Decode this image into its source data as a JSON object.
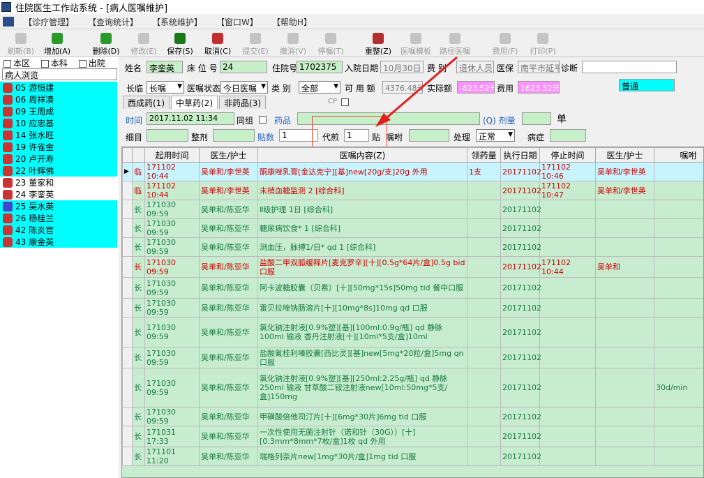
{
  "window": {
    "title": "住院医生工作站系统 - [病人医嘱维护]"
  },
  "menu": [
    "【诊疗管理】",
    "【查询统计】",
    "【系统维护】",
    "【窗口W】",
    "【帮助H】"
  ],
  "toolbar": [
    {
      "label": "刷新(B)",
      "state": "disabled"
    },
    {
      "label": "增加(A)",
      "state": "enabled"
    },
    {
      "label": "删除(D)",
      "state": "enabled"
    },
    {
      "label": "修改(E)",
      "state": "disabled"
    },
    {
      "label": "保存(S)",
      "state": "enabled"
    },
    {
      "label": "取消(C)",
      "state": "enabled"
    },
    {
      "label": "提交(E)",
      "state": "disabled"
    },
    {
      "label": "撤消(V)",
      "state": "disabled"
    },
    {
      "label": "停嘱(T)",
      "state": "disabled"
    },
    {
      "label": "重整(Z)",
      "state": "enabled"
    },
    {
      "label": "医嘱模板",
      "state": "disabled"
    },
    {
      "label": "路径医嘱",
      "state": "disabled"
    },
    {
      "label": "费用(F)",
      "state": "disabled"
    },
    {
      "label": "打印(P)",
      "state": "disabled"
    }
  ],
  "filters": {
    "ward": "本区",
    "dept": "本科",
    "discharged": "出院"
  },
  "patient_list": {
    "title": "病人浏览",
    "items": [
      {
        "bed": "05",
        "name": "游恒建"
      },
      {
        "bed": "06",
        "name": "周祥凑"
      },
      {
        "bed": "09",
        "name": "王周成"
      },
      {
        "bed": "10",
        "name": "应忠基"
      },
      {
        "bed": "14",
        "name": "张水旺"
      },
      {
        "bed": "19",
        "name": "许雀金"
      },
      {
        "bed": "20",
        "name": "卢开寿"
      },
      {
        "bed": "22",
        "name": "叶辉佛"
      },
      {
        "bed": "23",
        "name": "董家和"
      },
      {
        "bed": "24",
        "name": "李銮英"
      },
      {
        "bed": "25",
        "name": "吴水英"
      },
      {
        "bed": "26",
        "name": "杨桂兰"
      },
      {
        "bed": "42",
        "name": "陈炎官"
      },
      {
        "bed": "43",
        "name": "康金英"
      }
    ]
  },
  "info": {
    "name_label": "姓名",
    "name": "李銮英",
    "bed_label": "床 位 号",
    "bed": "24",
    "adm_no_label": "住院号",
    "adm_no": "1702375",
    "adm_date_label": "入院日期",
    "adm_date": "10月30日",
    "fee_cat_label": "费  别",
    "fee_cat": "退休人员",
    "ins_label": "医保",
    "ins": "南平市延平",
    "diag_label": "诊断",
    "diag": "",
    "term_label": "长临",
    "term": "长嘱",
    "status_label": "医嘱状态",
    "status": "今日医嘱",
    "type_label": "类  别",
    "type": "全部",
    "avail_label": "可 用 额",
    "avail": "4376.48元",
    "actual_label": "实际额",
    "actual": "-623.52元",
    "fee_label": "费用",
    "fee": "1623.52元",
    "level": "普通"
  },
  "tabs": [
    "西成药(1)",
    "中草药(2)",
    "非药品(3)"
  ],
  "entry": {
    "time_label": "时间",
    "time": "2017.11.02 11:34",
    "group_label": "同组",
    "drug_label": "药品",
    "drug": "",
    "dose_label": "(Q) 剂量",
    "dose": "",
    "unit": "单",
    "detail_label": "细目",
    "detail": "",
    "whole_label": "整剂",
    "whole": "",
    "packs_label": "贴数",
    "packs": "1",
    "prev_label": "代煎",
    "prev": "1",
    "tie": "贴",
    "note_label": "嘱咐",
    "note": "",
    "handle_label": "处理",
    "handle": "正常",
    "cp": "CP",
    "illness_label": "病症",
    "illness": ""
  },
  "table": {
    "headers": [
      "起用时间",
      "医生/护士",
      "医嘱内容(Z)",
      "领药量",
      "执行日期",
      "停止时间",
      "医生/护士",
      "嘱咐"
    ],
    "rows": [
      {
        "t": "临",
        "start": "171102 10:44",
        "doc": "吴单和/李世英",
        "content": "酮康唑乳膏[金达克宁][基]new[20g/支]20g  外用",
        "qty": "1支",
        "exec": "20171102",
        "stop": "171102 10:46",
        "doc2": "吴单和/李世英",
        "note": "",
        "red": true,
        "hl": true
      },
      {
        "t": "临",
        "start": "171102 10:44",
        "doc": "吴单和/李世英",
        "content": "末梢血糖监测  2 [综合科]",
        "qty": "",
        "exec": "20171102",
        "stop": "171102 10:47",
        "doc2": "吴单和/李世英",
        "note": "",
        "red": true
      },
      {
        "t": "长",
        "start": "171030 09:59",
        "doc": "吴单和/陈亚华",
        "content": "Ⅱ级护理  1日 [综合科]",
        "qty": "",
        "exec": "20171102",
        "stop": "",
        "doc2": "",
        "note": ""
      },
      {
        "t": "长",
        "start": "171030 09:59",
        "doc": "吴单和/陈亚华",
        "content": "糖尿病饮食*  1 [综合科]",
        "qty": "",
        "exec": "20171102",
        "stop": "",
        "doc2": "",
        "note": ""
      },
      {
        "t": "长",
        "start": "171030 09:59",
        "doc": "吴单和/陈亚华",
        "content": "测血压，脉搏1/日* qd 1 [综合科]",
        "qty": "",
        "exec": "20171102",
        "stop": "",
        "doc2": "",
        "note": ""
      },
      {
        "t": "长",
        "start": "171030 09:59",
        "doc": "吴单和/陈亚华",
        "content": "盐酸二甲双胍缓释片[麦克罗辛][十][0.5g*64片/盒]0.5g bid 口服",
        "qty": "",
        "exec": "20171102",
        "stop": "171102 10:44",
        "doc2": "吴单和",
        "note": "",
        "red": true,
        "h": 2
      },
      {
        "t": "长",
        "start": "171030 09:59",
        "doc": "吴单和/陈亚华",
        "content": "阿卡波糖胶囊（贝希）[十][50mg*15s]50mg tid 餐中口服",
        "qty": "",
        "exec": "20171102",
        "stop": "",
        "doc2": "",
        "note": "",
        "h": 2
      },
      {
        "t": "长",
        "start": "171030 09:59",
        "doc": "吴单和/陈亚华",
        "content": "雷贝拉唑钠肠溶片[十][10mg*8s]10mg qd 口服",
        "qty": "",
        "exec": "20171102",
        "stop": "",
        "doc2": "",
        "note": ""
      },
      {
        "t": "长",
        "start": "171030 09:59",
        "doc": "吴单和/陈亚华",
        "content": "氯化钠注射液[0.9%塑][基][100ml:0.9g/瓶] qd 静脉 100ml 输液 香丹注射液[十][10ml*5支/盒]10ml",
        "qty": "",
        "exec": "20171102",
        "stop": "",
        "doc2": "",
        "note": "",
        "h": 3
      },
      {
        "t": "长",
        "start": "171030 09:59",
        "doc": "吴单和/陈亚华",
        "content": "盐酸氟桂利嗪胶囊[西比灵][基]new[5mg*20粒/盒]5mg qn 口服",
        "qty": "",
        "exec": "20171102",
        "stop": "",
        "doc2": "",
        "note": "",
        "h": 2
      },
      {
        "t": "长",
        "start": "171030 09:59",
        "doc": "吴单和/陈亚华",
        "content": "氯化钠注射液[0.9%塑][基][250ml:2.25g/瓶] qd 静脉 250ml 输液 甘草酸二铵注射液new[10ml:50mg*5支/盒]150mg",
        "qty": "",
        "exec": "20171102",
        "stop": "",
        "doc2": "",
        "note": "30d/min",
        "h": 4
      },
      {
        "t": "长",
        "start": "171030 09:59",
        "doc": "吴单和/陈亚华",
        "content": "甲磺酸倍他司汀片[十][6mg*30片]6mg tid 口服",
        "qty": "",
        "exec": "20171102",
        "stop": "",
        "doc2": "",
        "note": ""
      },
      {
        "t": "长",
        "start": "171031 17:33",
        "doc": "吴单和/陈亚华",
        "content": "一次性使用无菌注射针（诺和针（30G））[十][0.3mm*8mm*7枚/盒]1枚 qd 外用",
        "qty": "",
        "exec": "20171102",
        "stop": "",
        "doc2": "",
        "note": "",
        "h": 2
      },
      {
        "t": "长",
        "start": "171101 11:20",
        "doc": "吴单和/陈亚华",
        "content": "瑞格列奈片new[1mg*30片/盒]1mg tid 口服",
        "qty": "",
        "exec": "20171102",
        "stop": "",
        "doc2": "",
        "note": ""
      }
    ]
  }
}
